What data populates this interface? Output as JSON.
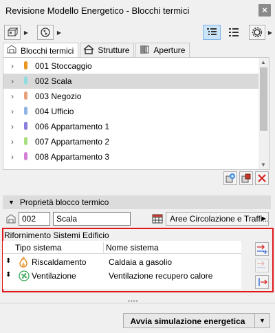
{
  "window": {
    "title": "Revisione Modello Energetico - Blocchi termici",
    "close_glyph": "×"
  },
  "toolbar": {
    "left_icons": [
      "model-icon",
      "refresh-icon"
    ],
    "right_icons": [
      "list-detail-icon",
      "list-icon",
      "settings-icon"
    ]
  },
  "tabs": [
    {
      "label": "Blocchi termici",
      "icon": "thermal-block-icon",
      "active": true
    },
    {
      "label": "Strutture",
      "icon": "structure-icon",
      "active": false
    },
    {
      "label": "Aperture",
      "icon": "opening-icon",
      "active": false
    }
  ],
  "blocks": [
    {
      "label": "001 Stoccaggio",
      "color": "#e8961e",
      "selected": false
    },
    {
      "label": "002 Scala",
      "color": "#8fdde0",
      "selected": true
    },
    {
      "label": "003 Negozio",
      "color": "#e6a07c",
      "selected": false
    },
    {
      "label": "004 Ufficio",
      "color": "#8fb4e2",
      "selected": false
    },
    {
      "label": "006 Appartamento 1",
      "color": "#8a7fdc",
      "selected": false
    },
    {
      "label": "007 Appartamento 2",
      "color": "#a9e07f",
      "selected": false
    },
    {
      "label": "008 Appartamento 3",
      "color": "#d37fd6",
      "selected": false
    }
  ],
  "list_buttons": [
    "add-block-icon",
    "assign-block-icon",
    "delete-icon"
  ],
  "properties": {
    "header": "Proprietà blocco termico",
    "id_value": "002",
    "name_value": "Scala",
    "area_type": "Aree Circolazione e Traffi..."
  },
  "systems": {
    "title": "Rifornimento Sistemi Edificio",
    "columns": [
      "Tipo sistema",
      "Nome sistema"
    ],
    "rows": [
      {
        "type": "Riscaldamento",
        "name": "Caldaia a gasolio",
        "icon": "flame-icon"
      },
      {
        "type": "Ventilazione",
        "name": "Ventilazione recupero calore",
        "icon": "fan-icon"
      }
    ]
  },
  "footer": {
    "simulate_label": "Avvia simulazione energetica"
  }
}
